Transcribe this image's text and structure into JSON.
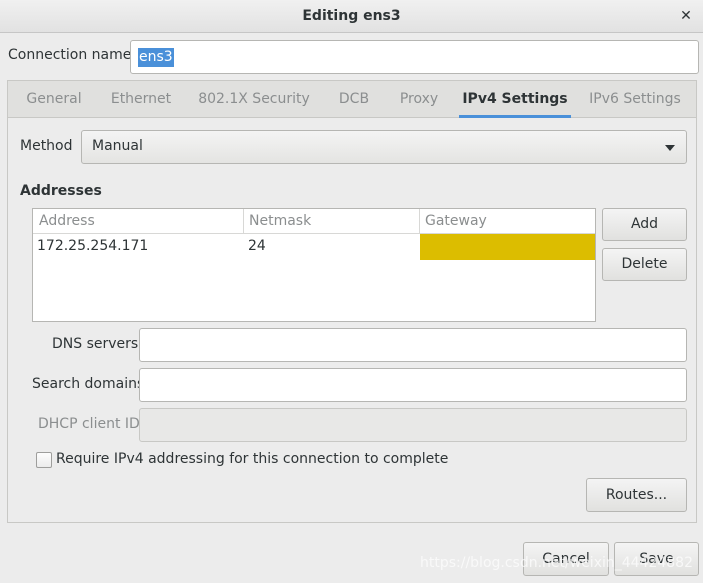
{
  "window": {
    "title": "Editing ens3",
    "close_glyph": "✕"
  },
  "connection": {
    "label": "Connection name",
    "value": "ens3"
  },
  "tabs": [
    {
      "label": "General"
    },
    {
      "label": "Ethernet"
    },
    {
      "label": "802.1X Security"
    },
    {
      "label": "DCB"
    },
    {
      "label": "Proxy"
    },
    {
      "label": "IPv4 Settings"
    },
    {
      "label": "IPv6 Settings"
    }
  ],
  "method": {
    "label": "Method",
    "value": "Manual"
  },
  "addresses": {
    "heading": "Addresses",
    "columns": [
      "Address",
      "Netmask",
      "Gateway"
    ],
    "rows": [
      {
        "address": "172.25.254.171",
        "netmask": "24",
        "gateway": ""
      }
    ],
    "add_label": "Add",
    "delete_label": "Delete"
  },
  "dns": {
    "label": "DNS servers",
    "value": ""
  },
  "search": {
    "label": "Search domains",
    "value": ""
  },
  "dhcp": {
    "label": "DHCP client ID",
    "value": ""
  },
  "require_ipv4": {
    "label": "Require IPv4 addressing for this connection to complete",
    "checked": false
  },
  "routes_label": "Routes...",
  "footer": {
    "cancel_label": "Cancel",
    "save_label": "Save"
  },
  "watermark": "https://blog.csdn.net/weixin_44424882",
  "colors": {
    "accent": "#4a90d9",
    "gateway_highlight": "#dcbd00"
  }
}
